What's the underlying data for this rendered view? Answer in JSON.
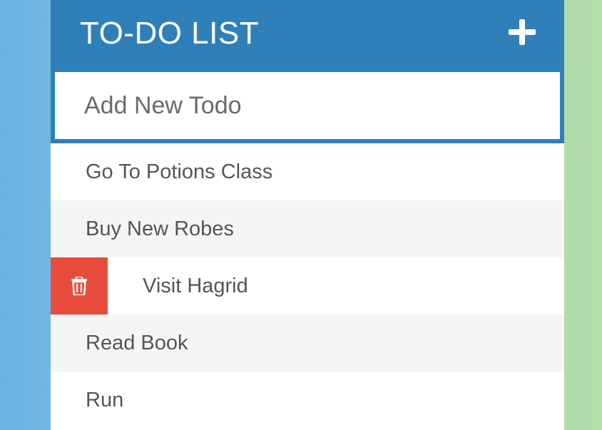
{
  "header": {
    "title": "TO-DO LIST",
    "add_icon": "plus-icon"
  },
  "new_todo": {
    "placeholder": "Add New Todo",
    "value": ""
  },
  "todos": [
    {
      "text": "Go To Potions Class"
    },
    {
      "text": "Buy New Robes"
    },
    {
      "text": "Visit Hagrid",
      "hovered": true,
      "delete_icon": "trash-icon"
    },
    {
      "text": "Read Book"
    },
    {
      "text": "Run"
    }
  ],
  "colors": {
    "header": "#2f80b8",
    "delete": "#e74c3c",
    "alt_row": "#f5f5f5",
    "text": "#555555"
  }
}
